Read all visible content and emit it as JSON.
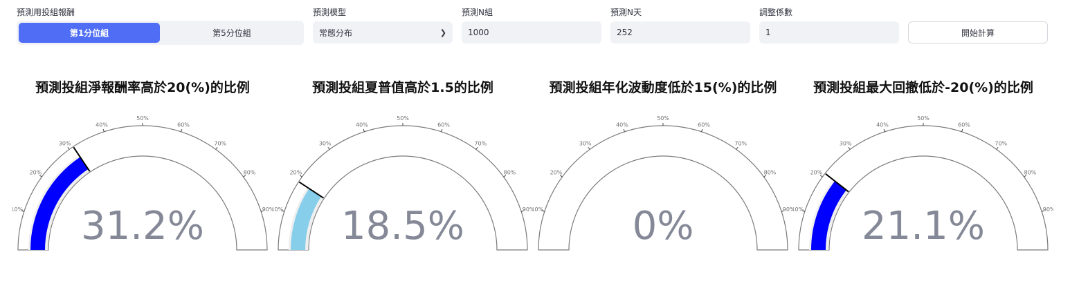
{
  "controls": {
    "portfolio": {
      "label": "預測用投組報酬",
      "options": [
        "第1分位組",
        "第5分位組"
      ],
      "selected": "第1分位組"
    },
    "model": {
      "label": "預測模型",
      "value": "常態分布"
    },
    "n_groups": {
      "label": "預測N組",
      "value": "1000"
    },
    "n_days": {
      "label": "預測N天",
      "value": "252"
    },
    "adjust": {
      "label": "調整係數",
      "value": "1"
    },
    "start_button": "開始計算"
  },
  "gauges": [
    {
      "title": "預測投組淨報酬率高於20(%)的比例",
      "value": 31.2,
      "display": "31.2%",
      "bar_color": "#0000ff"
    },
    {
      "title": "預測投組夏普值高於1.5的比例",
      "value": 18.5,
      "display": "18.5%",
      "bar_color": "#87ceeb"
    },
    {
      "title": "預測投組年化波動度低於15(%)的比例",
      "value": 0,
      "display": "0%",
      "bar_color": "#0000ff"
    },
    {
      "title": "預測投組最大回撤低於-20(%)的比例",
      "value": 21.1,
      "display": "21.1%",
      "bar_color": "#0000ff"
    }
  ],
  "gauge_axis": {
    "range": [
      0,
      100
    ],
    "tick_values": [
      10,
      20,
      30,
      40,
      50,
      60,
      70,
      80,
      90
    ],
    "tick_labels": [
      "10%",
      "20%",
      "30%",
      "40%",
      "50%",
      "60%",
      "70%",
      "80%",
      "90%"
    ],
    "track_color": "#efefef",
    "outline_color": "#7a7a7a"
  }
}
